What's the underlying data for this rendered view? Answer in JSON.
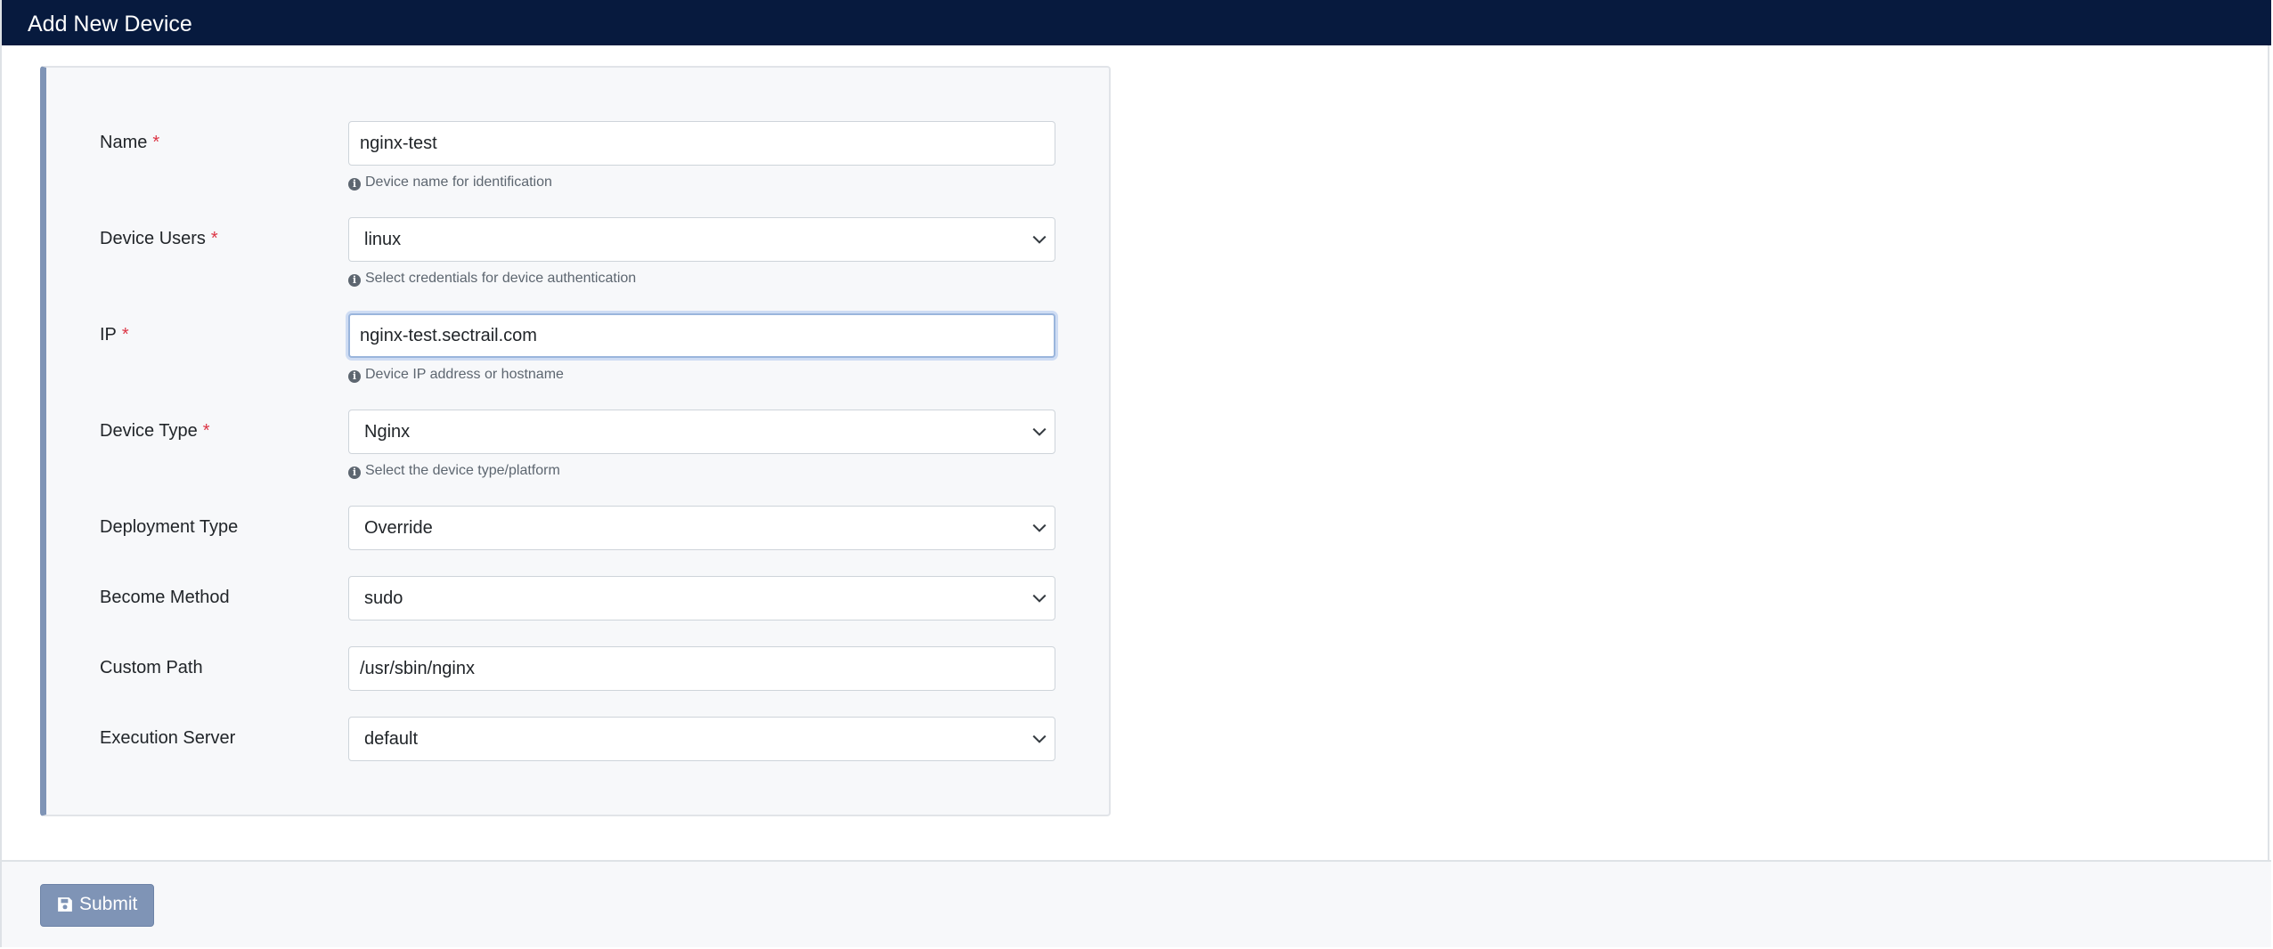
{
  "header": {
    "title": "Add New Device"
  },
  "form": {
    "name": {
      "label": "Name",
      "required": "*",
      "value": "nginx-test",
      "hint": "Device name for identification"
    },
    "device_users": {
      "label": "Device Users",
      "required": "*",
      "value": "linux",
      "hint": "Select credentials for device authentication"
    },
    "ip": {
      "label": "IP",
      "required": "*",
      "value": "nginx-test.sectrail.com",
      "hint": "Device IP address or hostname"
    },
    "device_type": {
      "label": "Device Type",
      "required": "*",
      "value": "Nginx",
      "hint": "Select the device type/platform"
    },
    "deployment_type": {
      "label": "Deployment Type",
      "value": "Override"
    },
    "become_method": {
      "label": "Become Method",
      "value": "sudo"
    },
    "custom_path": {
      "label": "Custom Path",
      "value": "/usr/sbin/nginx"
    },
    "execution_server": {
      "label": "Execution Server",
      "value": "default"
    }
  },
  "footer": {
    "submit_label": "Submit"
  },
  "icons": {
    "info": "info-circle-icon",
    "chevron": "chevron-down-icon",
    "save": "floppy-disk-icon"
  },
  "colors": {
    "header_bg": "#071a3e",
    "panel_accent": "#7f94b6",
    "required": "#dc3545",
    "submit_bg": "#7f94b6"
  }
}
